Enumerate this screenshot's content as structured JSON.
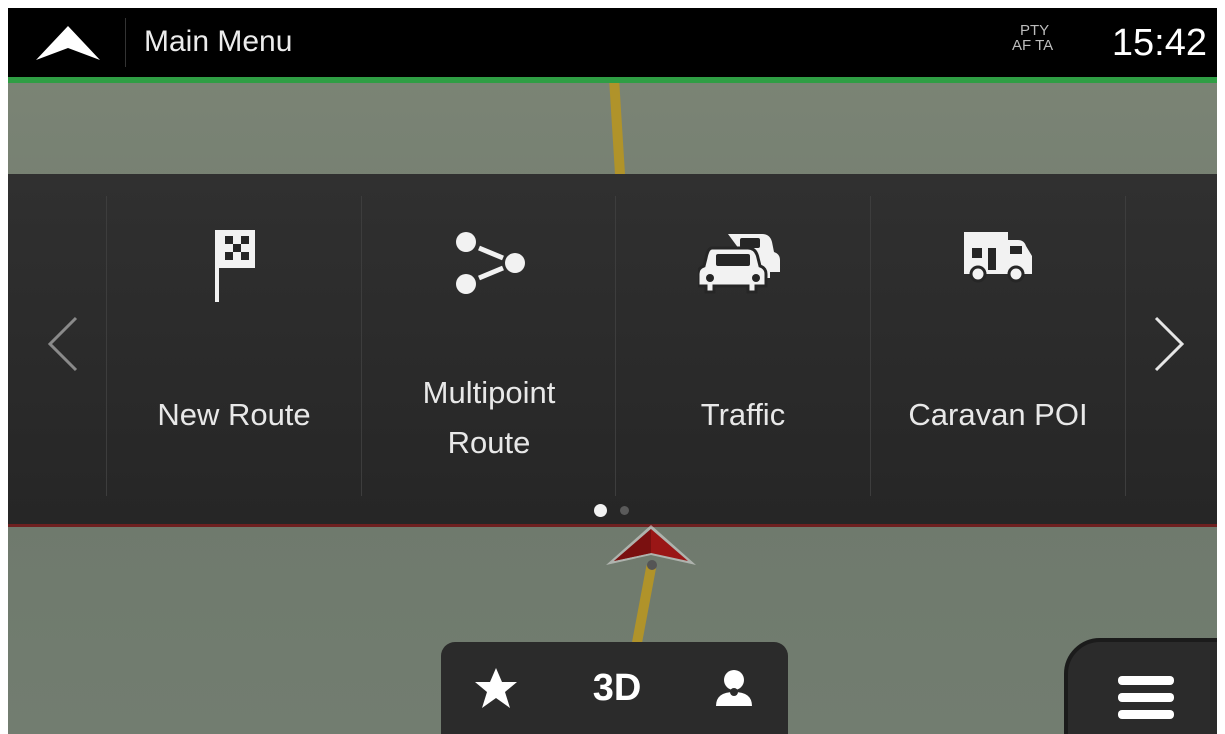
{
  "header": {
    "title": "Main Menu",
    "status_top": "PTY",
    "status_bottom": "AF TA",
    "time": "15:42"
  },
  "menu": {
    "items": [
      {
        "label_line1": "New Route",
        "label_line2": "",
        "icon": "checkered-flag-icon"
      },
      {
        "label_line1": "Multipoint",
        "label_line2": "Route",
        "icon": "multipoint-route-icon"
      },
      {
        "label_line1": "Traffic",
        "label_line2": "",
        "icon": "traffic-cars-icon"
      },
      {
        "label_line1": "Caravan POI",
        "label_line2": "",
        "icon": "caravan-icon"
      }
    ],
    "page_current": 1,
    "page_total": 2
  },
  "bottom_bar": {
    "view_label": "3D",
    "icons": [
      "star-icon",
      "person-icon"
    ]
  },
  "colors": {
    "accent_green": "#2f9e44",
    "panel_bg": "#2a2a2a",
    "road": "#b0932a",
    "marker": "#9a1616"
  }
}
